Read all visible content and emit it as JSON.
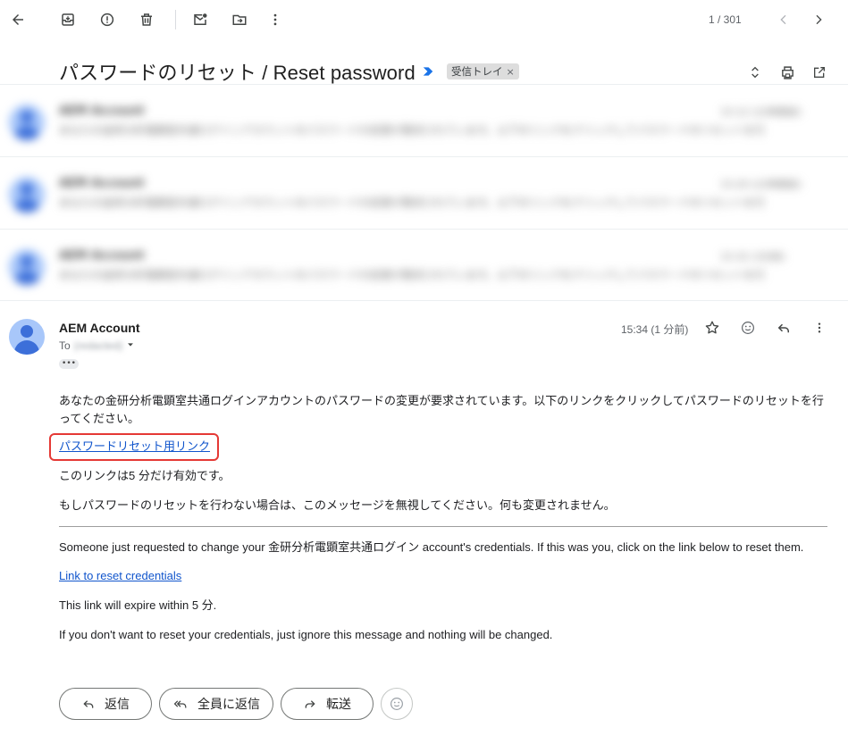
{
  "toolbar": {
    "back_icon": "arrow-left-icon",
    "archive_icon": "archive-icon",
    "report_icon": "report-spam-icon",
    "delete_icon": "trash-icon",
    "mark_unread_icon": "mark-unread-icon",
    "move_icon": "move-to-icon",
    "more_icon": "more-vert-icon",
    "counter": "1 / 301",
    "prev_icon": "chevron-left-icon",
    "next_icon": "chevron-right-icon"
  },
  "thread": {
    "subject": "パスワードのリセット / Reset password",
    "importance_icon": "importance-marker-icon",
    "label": "受信トレイ",
    "label_remove": "×",
    "expand_icon": "unfold-icon",
    "print_icon": "print-icon",
    "open_new_window_icon": "open-new-window-icon"
  },
  "collapsed_messages": [
    {
      "sender": "AEM Account",
      "snippet": "あなたの金研分析電顕室共通ログインアカウントのパスワードの変更が要求されています。以下のリンクをクリックしてパスワードのリセットを行",
      "time": "15:12 (22時間前)"
    },
    {
      "sender": "AEM Account",
      "snippet": "あなたの金研分析電顕室共通ログインアカウントのパスワードの変更が要求されています。以下のリンクをクリックしてパスワードのリセットを行",
      "time": "15:20 (22時間前)"
    },
    {
      "sender": "AEM Account",
      "snippet": "あなたの金研分析電顕室共通ログインアカウントのパスワードの変更が要求されています。以下のリンクをクリックしてパスワードのリセットを行",
      "time": "15:32 (3分前)"
    }
  ],
  "message": {
    "sender": "AEM Account",
    "to_label": "To",
    "to_address": "(redacted)",
    "time": "15:34 (1 分前)",
    "dots": "•••",
    "star_icon": "star-outline-icon",
    "emoji_icon": "add-reaction-icon",
    "reply_icon": "reply-icon",
    "more_icon": "more-vert-icon",
    "jp_paragraph": "あなたの金研分析電顕室共通ログインアカウントのパスワードの変更が要求されています。以下のリンクをクリックしてパスワードのリセットを行ってください。",
    "jp_link": "パスワードリセット用リンク",
    "jp_expire": "このリンクは5 分だけ有効です。",
    "jp_ignore": "もしパスワードのリセットを行わない場合は、このメッセージを無視してください。何も変更されません。",
    "en_paragraph": "Someone just requested to change your 金研分析電顕室共通ログイン account's credentials. If this was you, click on the link below to reset them.",
    "en_link": "Link to reset credentials",
    "en_expire": "This link will expire within 5 分.",
    "en_ignore": "If you don't want to reset your credentials, just ignore this message and nothing will be changed."
  },
  "actions": {
    "reply": "返信",
    "reply_all": "全員に返信",
    "forward": "転送",
    "emoji_icon": "add-reaction-icon"
  }
}
